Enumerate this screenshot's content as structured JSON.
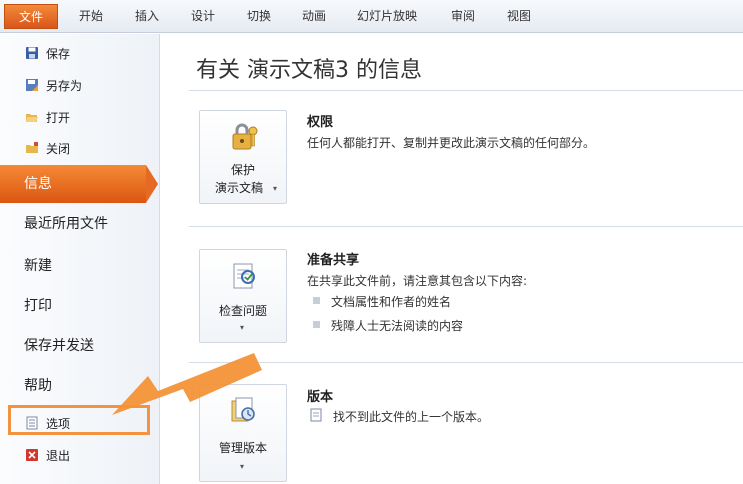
{
  "ribbon": {
    "file_tab": "文件",
    "tabs": [
      "开始",
      "插入",
      "设计",
      "切换",
      "动画",
      "幻灯片放映",
      "审阅",
      "视图"
    ]
  },
  "nav": {
    "save": "保存",
    "save_as": "另存为",
    "open": "打开",
    "close": "关闭",
    "info": "信息",
    "recent": "最近所用文件",
    "new": "新建",
    "print": "打印",
    "save_send": "保存并发送",
    "help": "帮助",
    "options": "选项",
    "exit": "退出"
  },
  "main": {
    "title": "有关 演示文稿3 的信息",
    "permissions": {
      "button_line1": "保护",
      "button_line2": "演示文稿",
      "heading": "权限",
      "text": "任何人都能打开、复制并更改此演示文稿的任何部分。"
    },
    "share": {
      "button": "检查问题",
      "heading": "准备共享",
      "text": "在共享此文件前，请注意其包含以下内容:",
      "items": [
        "文档属性和作者的姓名",
        "残障人士无法阅读的内容"
      ]
    },
    "versions": {
      "button": "管理版本",
      "heading": "版本",
      "text": "找不到此文件的上一个版本。"
    }
  },
  "colors": {
    "accent_orange": "#e56a23",
    "annotation_orange": "#f3923f"
  }
}
